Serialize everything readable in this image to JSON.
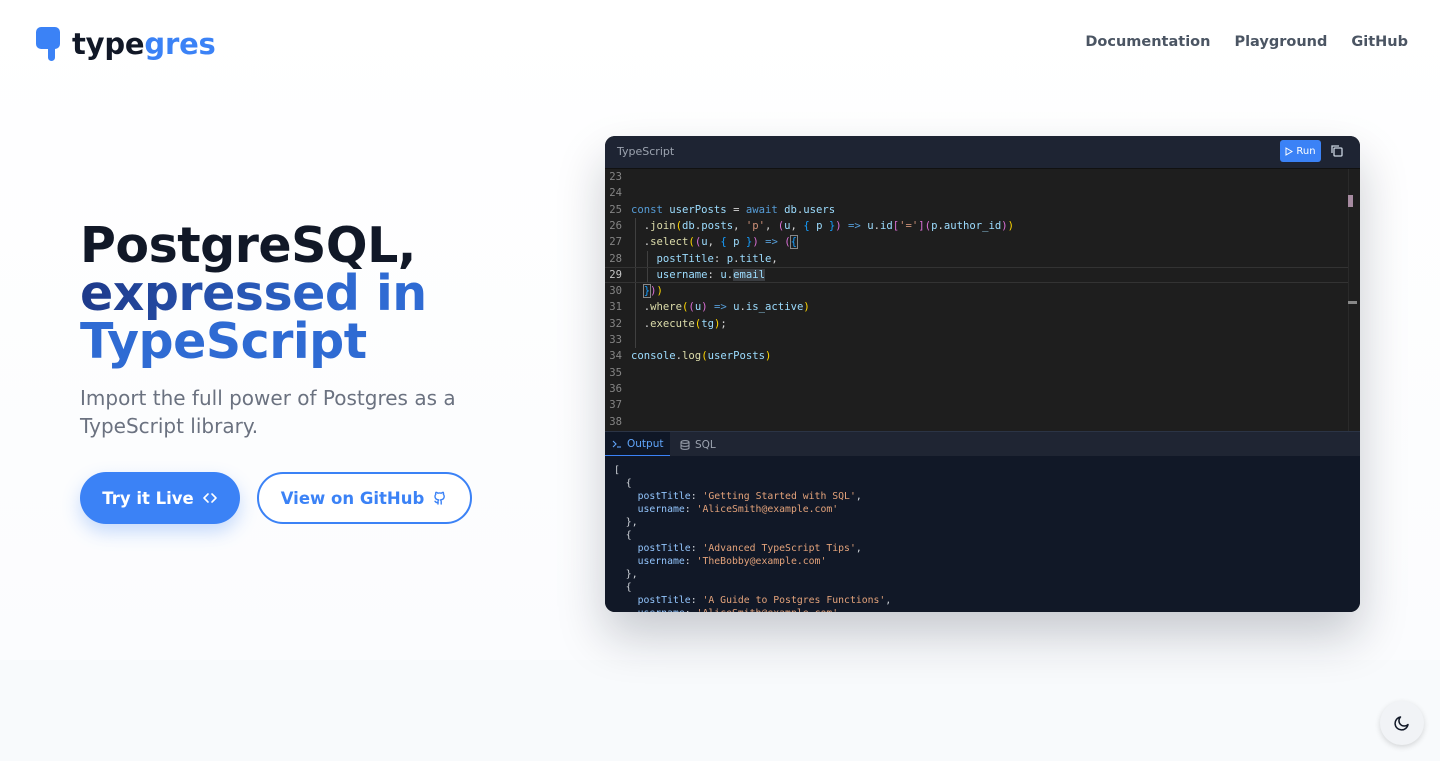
{
  "header": {
    "logo_part1": "type",
    "logo_part2": "gres",
    "nav": [
      "Documentation",
      "Playground",
      "GitHub"
    ]
  },
  "hero": {
    "title_line1": "PostgreSQL,",
    "title_line2_a": "expressed",
    "title_line2_b": " in",
    "title_line3": "TypeScript",
    "subtitle": "Import the full power of Postgres as a TypeScript library.",
    "primary_button": "Try it Live",
    "secondary_button": "View on GitHub"
  },
  "editor": {
    "language": "TypeScript",
    "run_label": "Run",
    "line_numbers": [
      "23",
      "24",
      "25",
      "26",
      "27",
      "28",
      "29",
      "30",
      "31",
      "32",
      "33",
      "34",
      "35",
      "36",
      "37",
      "38"
    ],
    "active_line": "29",
    "tabs": {
      "output": "Output",
      "sql": "SQL"
    },
    "output_lines": [
      "[",
      "  {",
      "    postTitle: 'Getting Started with SQL',",
      "    username: 'AliceSmith@example.com'",
      "  },",
      "  {",
      "    postTitle: 'Advanced TypeScript Tips',",
      "    username: 'TheBobby@example.com'",
      "  },",
      "  {",
      "    postTitle: 'A Guide to Postgres Functions',",
      "    username: 'AliceSmith@example.com'"
    ]
  },
  "colors": {
    "accent": "#3b82f6",
    "title_blue": "#2f6bd3",
    "editor_bg": "#1e1e1e",
    "output_bg": "#111827"
  },
  "icons": {
    "logo": "elephant-logo-icon",
    "primary_button": "code-brackets-icon",
    "secondary_button": "github-icon",
    "run": "play-icon",
    "copy": "copy-icon",
    "output_tab": "terminal-icon",
    "sql_tab": "database-icon",
    "theme": "moon-icon"
  }
}
